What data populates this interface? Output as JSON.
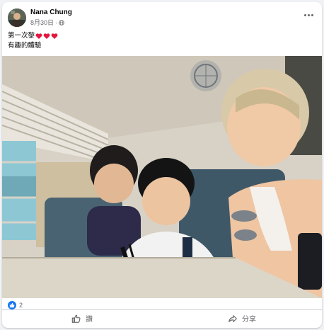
{
  "post": {
    "author": "Nana Chung",
    "date": "8月30日",
    "separator": "·",
    "caption_line1": "第一次黎",
    "caption_line2": "有趣的體驗",
    "audience_icon": "globe-icon",
    "heart_color": "#e4173e"
  },
  "reactions": {
    "count": "2",
    "icon": "like-icon",
    "color": "#1877f2"
  },
  "actions": {
    "like_label": "讚",
    "share_label": "分享"
  }
}
